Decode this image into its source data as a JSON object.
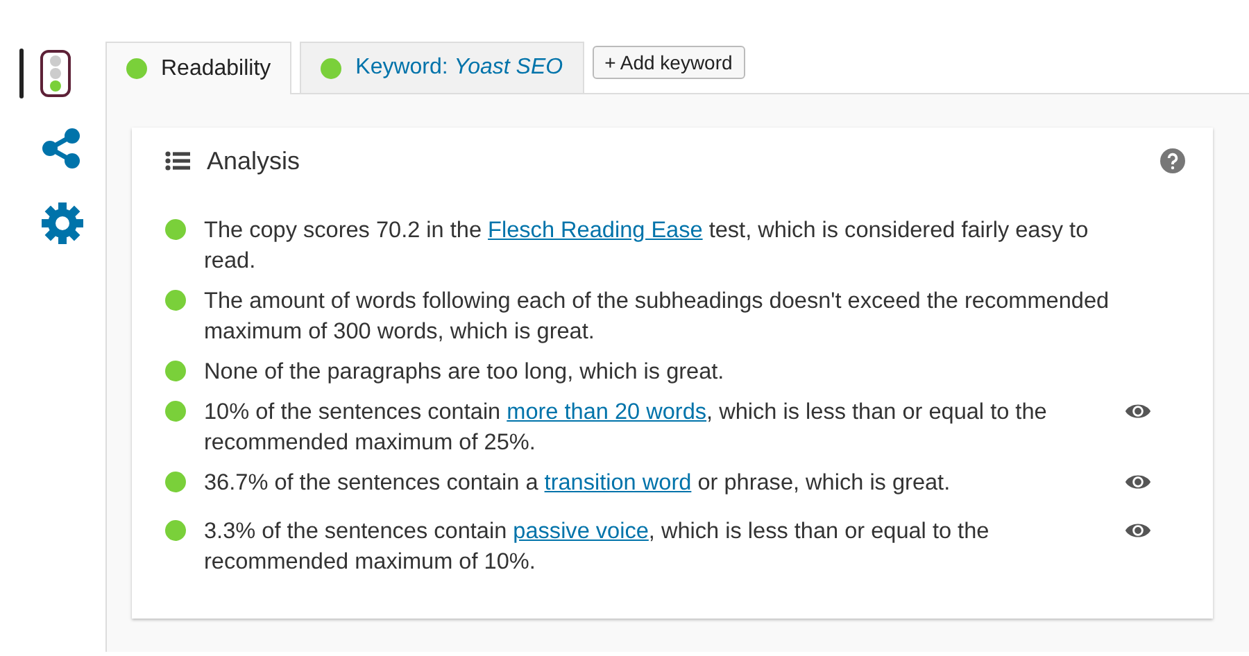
{
  "sidebar": {
    "items": [
      {
        "kind": "traffic-light",
        "selected": true
      },
      {
        "kind": "share",
        "selected": false
      },
      {
        "kind": "gear",
        "selected": false
      }
    ]
  },
  "tabs": [
    {
      "kind": "plain",
      "label": "Readability",
      "selected": true,
      "color": "#7ad03a"
    },
    {
      "kind": "keyword",
      "prefix": "Keyword: ",
      "label": "Yoast SEO",
      "selected": false,
      "color": "#7ad03a"
    }
  ],
  "add_button": "+ Add keyword",
  "panel": {
    "title": "Analysis",
    "results": [
      {
        "before": "The copy scores 70.2 in the ",
        "link": "Flesch Reading Ease",
        "after": " test, which is considered fairly easy to read.",
        "eye": false,
        "color": "#7ad03a"
      },
      {
        "before": "The amount of words following each of the subheadings doesn't exceed the recommended maximum of 300 words, which is great.",
        "eye": false,
        "color": "#7ad03a"
      },
      {
        "before": "None of the paragraphs are too long, which is great.",
        "eye": false,
        "color": "#7ad03a"
      },
      {
        "before": "10% of the sentences contain ",
        "link": "more than 20 words",
        "after": ", which is less than or equal to the recommended maximum of 25%.",
        "eye": true,
        "color": "#7ad03a"
      },
      {
        "before": "36.7% of the sentences contain a ",
        "link": "transition word",
        "after": " or phrase, which is great.",
        "eye": true,
        "color": "#7ad03a"
      },
      {
        "before": "3.3% of the sentences contain ",
        "link": "passive voice",
        "after": ", which is less than or equal to the recommended maximum of 10%.",
        "eye": true,
        "color": "#7ad03a"
      }
    ]
  }
}
